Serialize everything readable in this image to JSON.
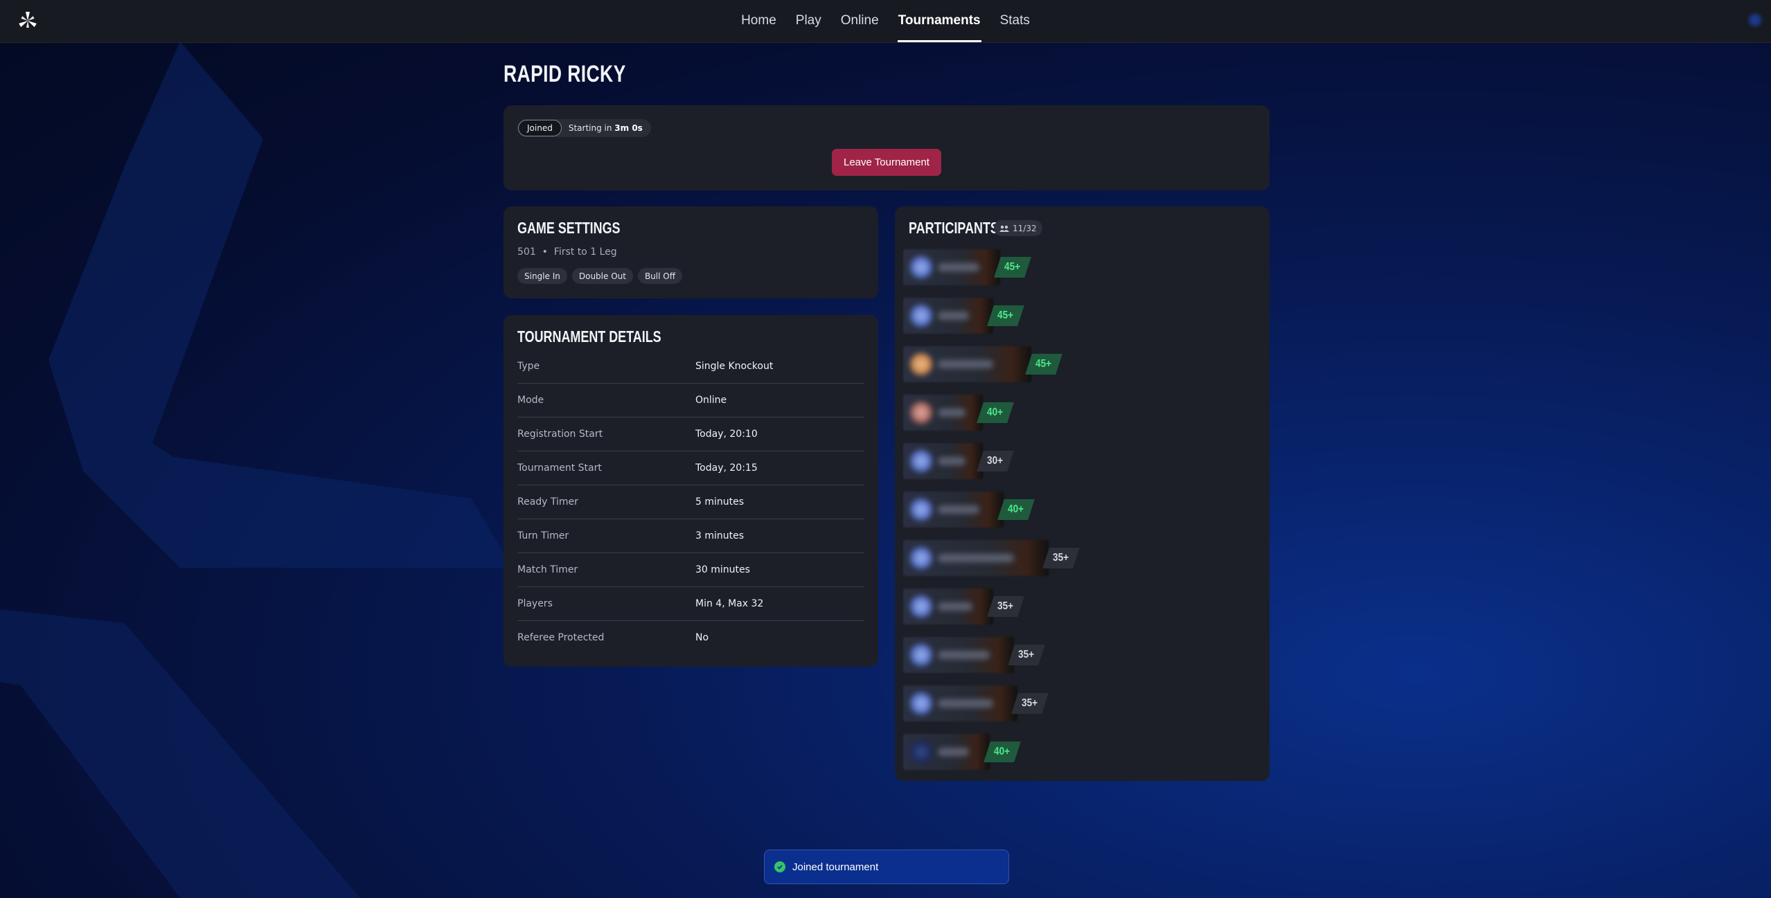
{
  "nav": {
    "items": [
      {
        "label": "Home",
        "active": false
      },
      {
        "label": "Play",
        "active": false
      },
      {
        "label": "Online",
        "active": false
      },
      {
        "label": "Tournaments",
        "active": true
      },
      {
        "label": "Stats",
        "active": false
      }
    ]
  },
  "tournament": {
    "title": "RAPID RICKY",
    "status_label": "Joined",
    "starting_prefix": "Starting in ",
    "starting_time": "3m 0s",
    "leave_label": "Leave Tournament"
  },
  "game_settings": {
    "heading": "GAME SETTINGS",
    "summary": "501  •  First to 1 Leg",
    "tags": [
      "Single In",
      "Double Out",
      "Bull Off"
    ]
  },
  "details": {
    "heading": "TOURNAMENT DETAILS",
    "rows": [
      {
        "label": "Type",
        "value": "Single Knockout"
      },
      {
        "label": "Mode",
        "value": "Online"
      },
      {
        "label": "Registration Start",
        "value": "Today, 20:10"
      },
      {
        "label": "Tournament Start",
        "value": "Today, 20:15"
      },
      {
        "label": "Ready Timer",
        "value": "5 minutes"
      },
      {
        "label": "Turn Timer",
        "value": "3 minutes"
      },
      {
        "label": "Match Timer",
        "value": "30 minutes"
      },
      {
        "label": "Players",
        "value": "Min 4, Max 32"
      },
      {
        "label": "Referee Protected",
        "value": "No"
      }
    ]
  },
  "participants": {
    "heading": "PARTICIPANTS",
    "count": "11/32",
    "list": [
      {
        "level": "45+",
        "color": "green"
      },
      {
        "level": "45+",
        "color": "green"
      },
      {
        "level": "45+",
        "color": "green"
      },
      {
        "level": "40+",
        "color": "green"
      },
      {
        "level": "30+",
        "color": "gray"
      },
      {
        "level": "40+",
        "color": "green"
      },
      {
        "level": "35+",
        "color": "gray"
      },
      {
        "level": "35+",
        "color": "gray"
      },
      {
        "level": "35+",
        "color": "gray"
      },
      {
        "level": "35+",
        "color": "gray"
      },
      {
        "level": "40+",
        "color": "green"
      }
    ]
  },
  "toast": {
    "message": "Joined tournament"
  }
}
